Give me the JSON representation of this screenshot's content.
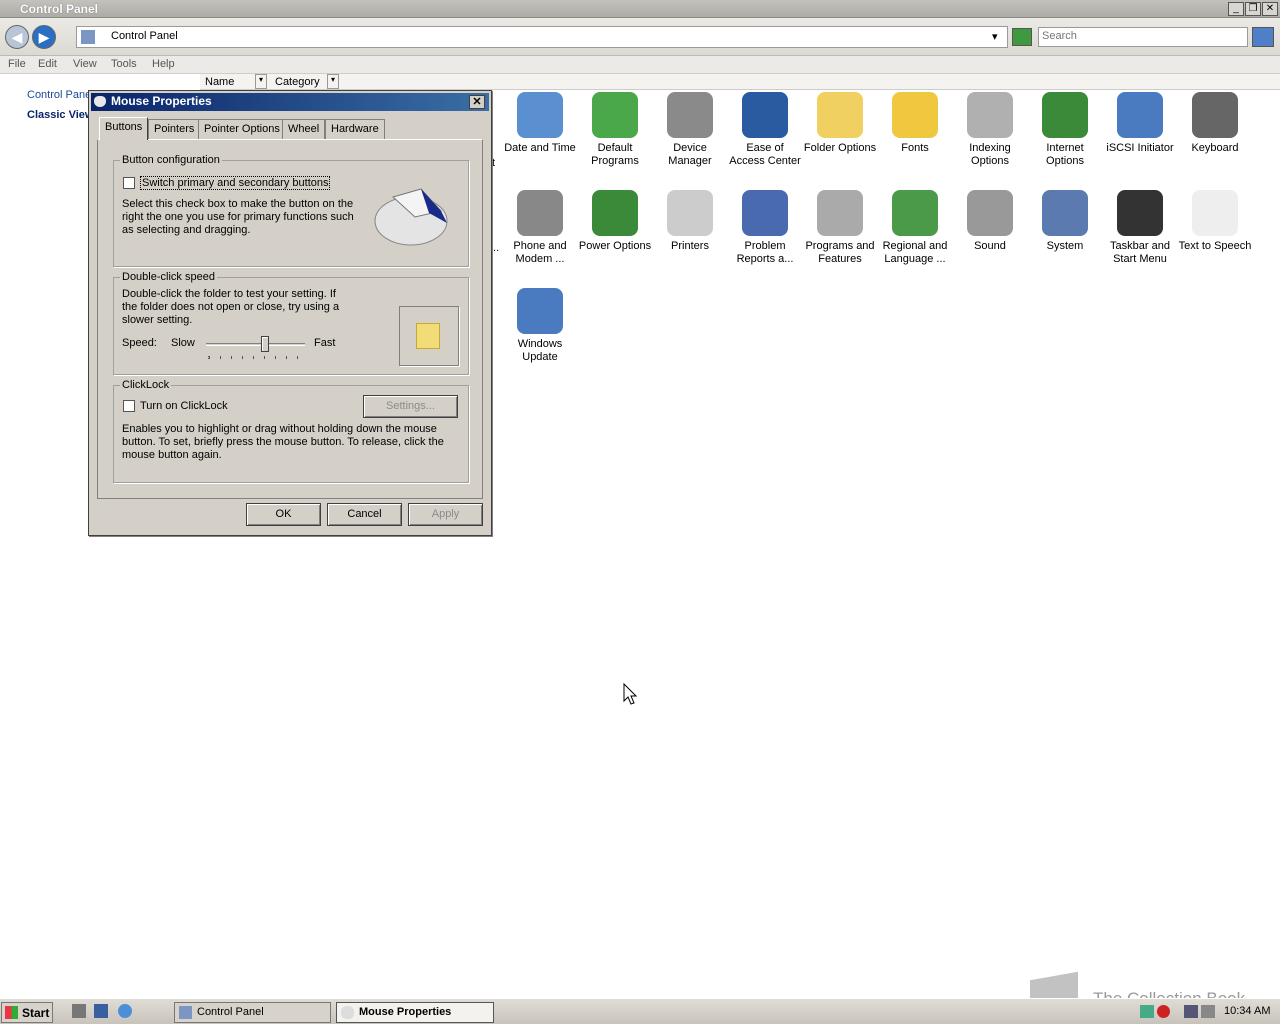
{
  "window": {
    "title": "Control Panel"
  },
  "address": {
    "path": "Control Panel",
    "search_placeholder": "Search"
  },
  "menu": [
    "File",
    "Edit",
    "View",
    "Tools",
    "Help"
  ],
  "columns": [
    "Name",
    "Category"
  ],
  "left": {
    "link1": "Control Panel",
    "link2": "Classic View"
  },
  "icons_row1": [
    "Date and Time",
    "Default Programs",
    "Device Manager",
    "Ease of Access Center",
    "Folder Options",
    "Fonts",
    "Indexing Options",
    "Internet Options",
    "iSCSI Initiator",
    "Keyboard"
  ],
  "icons_row2": [
    "Phone and Modem ...",
    "Power Options",
    "Printers",
    "Problem Reports a...",
    "Programs and Features",
    "Regional and Language ...",
    "Sound",
    "System",
    "Taskbar and Start Menu",
    "Text to Speech"
  ],
  "icons_row3": [
    "Windows Update"
  ],
  "partial_labels": {
    "r1": "t",
    "r2": "..."
  },
  "dialog": {
    "title": "Mouse Properties",
    "tabs": [
      "Buttons",
      "Pointers",
      "Pointer Options",
      "Wheel",
      "Hardware"
    ],
    "button_config": {
      "title": "Button configuration",
      "checkbox": "Switch primary and secondary buttons",
      "desc": "Select this check box to make the button on the right the one you use for primary functions such as selecting and dragging."
    },
    "dblclick": {
      "title": "Double-click speed",
      "desc": "Double-click the folder to test your setting. If the folder does not open or close, try using a slower setting.",
      "speed_label": "Speed:",
      "slow": "Slow",
      "fast": "Fast",
      "slider_level": 0.6
    },
    "clicklock": {
      "title": "ClickLock",
      "checkbox": "Turn on ClickLock",
      "settings": "Settings...",
      "desc": "Enables you to highlight or drag without holding down the mouse button. To set, briefly press the mouse button. To release, click the mouse button again."
    },
    "ok": "OK",
    "cancel": "Cancel",
    "apply": "Apply"
  },
  "taskbar": {
    "start": "Start",
    "items": [
      "Control Panel",
      "Mouse Properties"
    ],
    "clock": "10:34 AM"
  },
  "watermark": "The Collection Book"
}
